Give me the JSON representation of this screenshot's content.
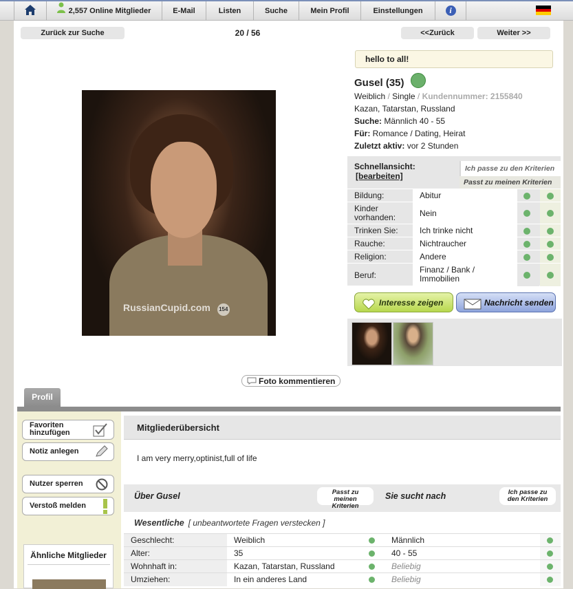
{
  "nav": {
    "online": "2,557 Online Mitglieder",
    "email": "E-Mail",
    "listen": "Listen",
    "suche": "Suche",
    "profil": "Mein Profil",
    "einstellungen": "Einstellungen",
    "info": "i"
  },
  "pager": {
    "back_search": "Zurück zur Suche",
    "count": "20 / 56",
    "prev": "<<Zurück",
    "next": "Weiter >>"
  },
  "photo": {
    "watermark": "RussianCupid.com",
    "badge": "154"
  },
  "profile": {
    "status": "hello to all!",
    "name": "Gusel (35)",
    "gender": "Weiblich",
    "sep": "/",
    "marital": "Single",
    "kundennummer": "Kundennummer: 2155840",
    "location": "Kazan, Tatarstan, Russland",
    "suche_label": "Suche:",
    "suche_value": "Männlich 40 - 55",
    "fuer_label": "Für:",
    "fuer_value": "Romance / Dating, Heirat",
    "aktiv_label": "Zuletzt aktiv:",
    "aktiv_value": "vor 2 Stunden"
  },
  "quickview": {
    "title": "Schnellansicht:",
    "edit": "[bearbeiten]",
    "h1": "Ich passe zu den Kriterien",
    "h2": "Passt zu meinen Kriterien",
    "rows": [
      {
        "label": "Bildung:",
        "value": "Abitur"
      },
      {
        "label": "Kinder vorhanden:",
        "value": "Nein"
      },
      {
        "label": "Trinken Sie:",
        "value": "Ich trinke nicht"
      },
      {
        "label": "Rauche:",
        "value": "Nichtraucher"
      },
      {
        "label": "Religion:",
        "value": "Andere"
      },
      {
        "label": "Beruf:",
        "value": "Finanz / Bank / Immobilien"
      }
    ]
  },
  "actions": {
    "interest": "Interesse zeigen",
    "message": "Nachricht senden",
    "comment": "Foto kommentieren"
  },
  "tab": "Profil",
  "sidebar": {
    "favorite": "Favoriten hinzufügen",
    "note": "Notiz anlegen",
    "block": "Nutzer sperren",
    "report": "Verstoß melden",
    "similar": "Ähnliche Mitglieder"
  },
  "overview": {
    "title": "Mitgliederübersicht",
    "about": "I am very merry,optinist,full of life",
    "ueber": "Über Gusel",
    "tag1": "Passt zu meinen Kriterien",
    "sucht": "Sie sucht nach",
    "tag2": "Ich passe zu den Kriterien",
    "wesentliche": "Wesentliche",
    "hide": "[ unbeantwortete Fragen verstecken ]",
    "rows": [
      {
        "label": "Geschlecht:",
        "a": "Weiblich",
        "b": "Männlich"
      },
      {
        "label": "Alter:",
        "a": "35",
        "b": "40 - 55"
      },
      {
        "label": "Wohnhaft in:",
        "a": "Kazan, Tatarstan, Russland",
        "b": "Beliebig"
      },
      {
        "label": "Umziehen:",
        "a": "In ein anderes Land",
        "b": "Beliebig"
      }
    ]
  },
  "colors": {
    "green": "#6cb36c",
    "navy": "#3b5fb6",
    "sidebar": "#f2f0d6"
  }
}
